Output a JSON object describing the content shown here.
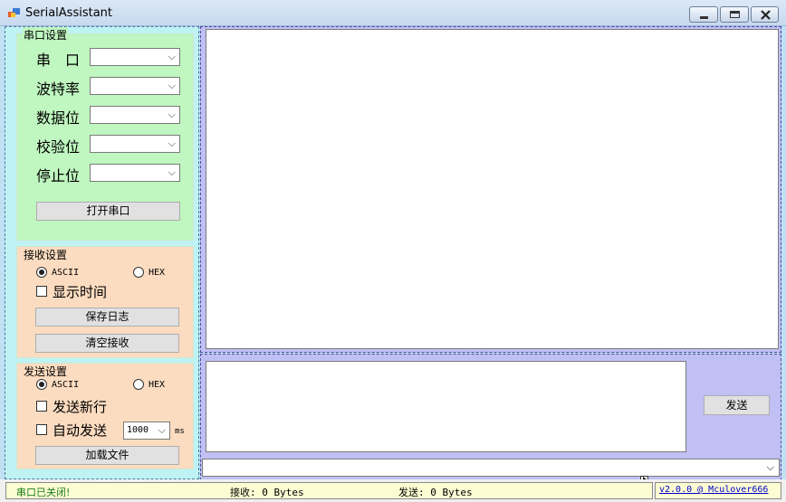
{
  "window": {
    "title": "SerialAssistant"
  },
  "serial_settings": {
    "title": "串口设置",
    "fields": [
      {
        "label": "串　口",
        "value": ""
      },
      {
        "label": "波特率",
        "value": ""
      },
      {
        "label": "数据位",
        "value": ""
      },
      {
        "label": "校验位",
        "value": ""
      },
      {
        "label": "停止位",
        "value": ""
      }
    ],
    "open_button": "打开串口"
  },
  "receive_settings": {
    "title": "接收设置",
    "radio_ascii": "ASCII",
    "radio_hex": "HEX",
    "selected": "ASCII",
    "show_time_label": "显示时间",
    "show_time_checked": false,
    "save_log_button": "保存日志",
    "clear_button": "清空接收"
  },
  "send_settings": {
    "title": "发送设置",
    "radio_ascii": "ASCII",
    "radio_hex": "HEX",
    "selected": "ASCII",
    "newline_label": "发送新行",
    "newline_checked": false,
    "auto_send_label": "自动发送",
    "auto_send_checked": false,
    "interval_value": "1000",
    "interval_unit": "ms",
    "load_file_button": "加载文件"
  },
  "main": {
    "receive_text": "",
    "send_text": "",
    "send_button": "发送",
    "history_value": ""
  },
  "status": {
    "port_state": "串口已关闭!",
    "received": "接收: 0 Bytes",
    "sent": "发送: 0 Bytes",
    "version": "v2.0.0 @ Mculover666"
  },
  "colors": {
    "serial_group": "#c0f6c0",
    "settings_group": "#fcdcc0",
    "right_panel": "#c0c0f5",
    "status_bg": "#fdfdd3"
  }
}
